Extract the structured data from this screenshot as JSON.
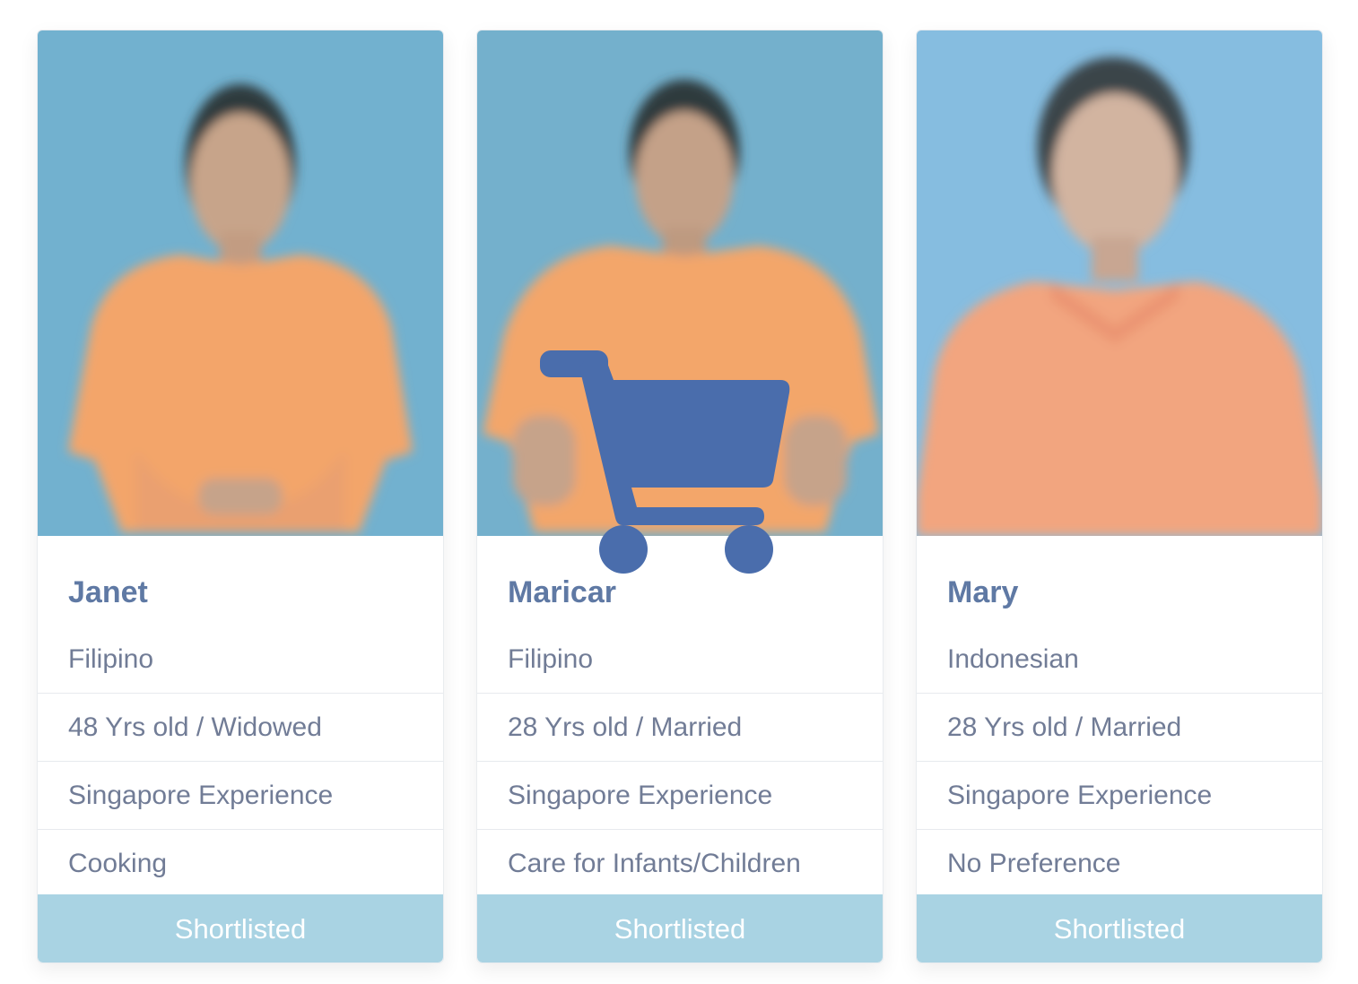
{
  "cards": [
    {
      "name": "Janet",
      "nationality": "Filipino",
      "age_status": "48 Yrs old / Widowed",
      "experience": "Singapore Experience",
      "skill": "Cooking",
      "button_label": "Shortlisted"
    },
    {
      "name": "Maricar",
      "nationality": "Filipino",
      "age_status": "28 Yrs old / Married",
      "experience": "Singapore Experience",
      "skill": "Care for Infants/Children",
      "button_label": "Shortlisted"
    },
    {
      "name": "Mary",
      "nationality": "Indonesian",
      "age_status": "28 Yrs old / Married",
      "experience": "Singapore Experience",
      "skill": "No Preference",
      "button_label": "Shortlisted"
    }
  ],
  "overlay": {
    "icon": "shopping-cart-icon"
  },
  "colors": {
    "name_text": "#5f79a4",
    "body_text": "#717c96",
    "button_bg": "#a9d3e3",
    "button_text": "#ffffff",
    "photo_bg_1": "#6fb0d0",
    "photo_bg_3": "#86bde0",
    "shirt": "#f4a56c",
    "cart": "#4a6dac"
  }
}
